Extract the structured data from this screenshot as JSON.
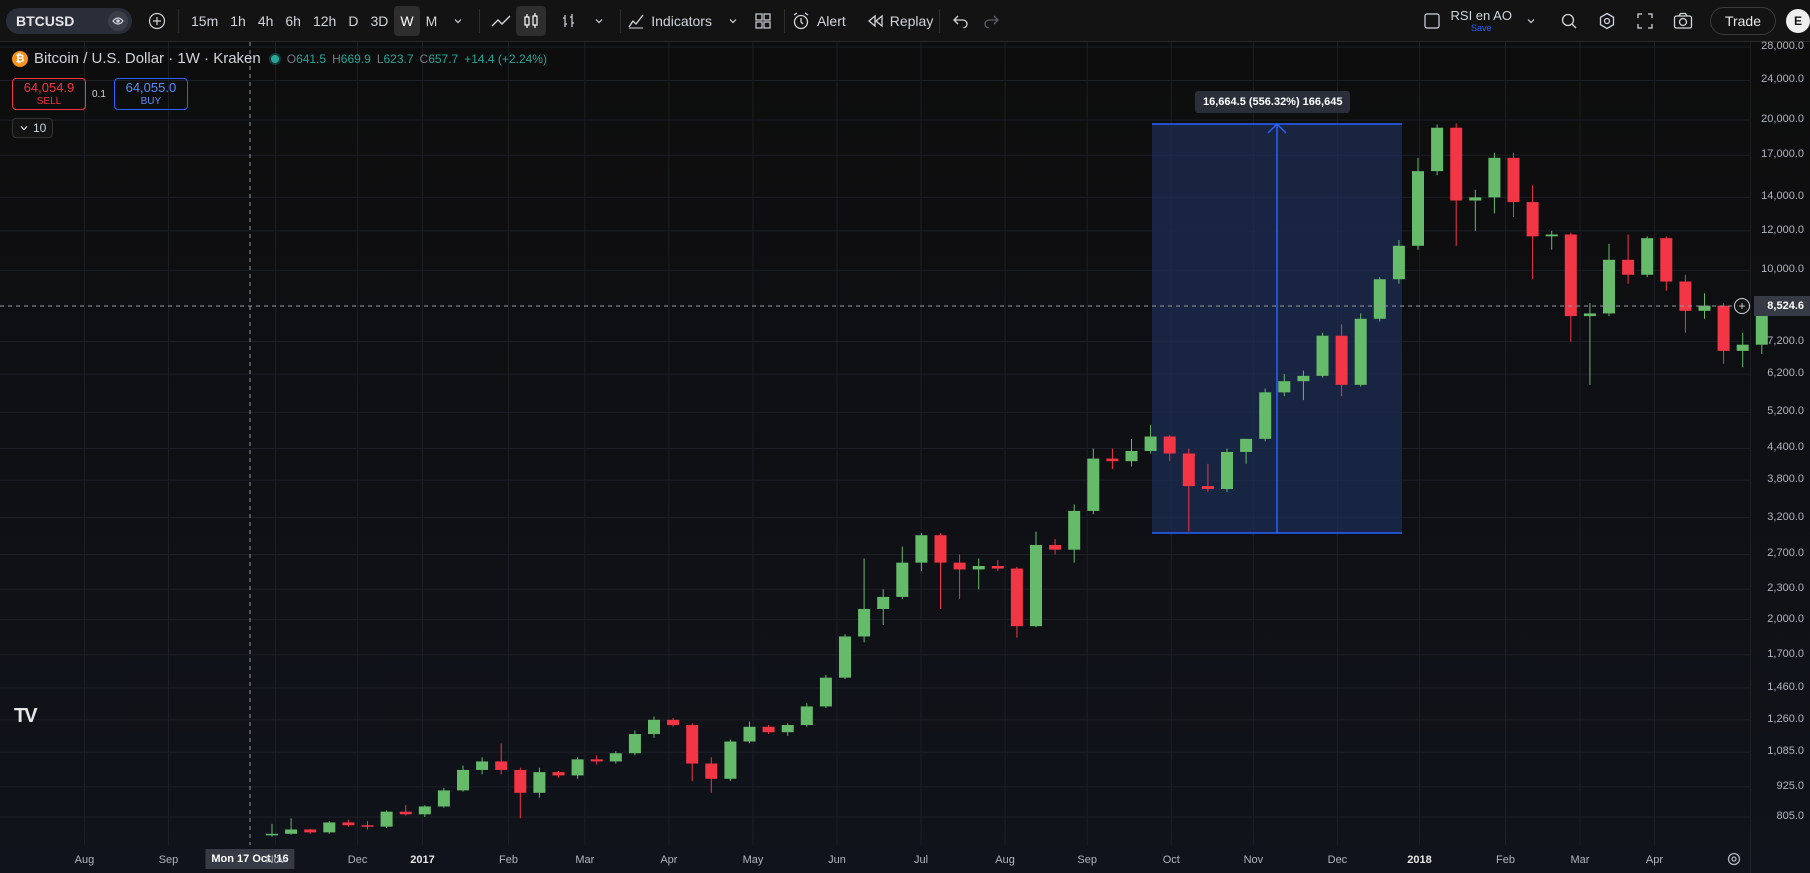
{
  "toolbar": {
    "symbol": "BTCUSD",
    "intervals": [
      "15m",
      "1h",
      "4h",
      "6h",
      "12h",
      "D",
      "3D",
      "W",
      "M"
    ],
    "active_interval": "W",
    "indicators_label": "Indicators",
    "alert_label": "Alert",
    "replay_label": "Replay",
    "layout_name": "RSI en AO",
    "layout_save": "Save",
    "trade_label": "Trade",
    "avatar_letter": "E"
  },
  "legend": {
    "title": "Bitcoin / U.S. Dollar · 1W · Kraken",
    "btc_glyph": "₿",
    "o_label": "O",
    "o_value": "641.5",
    "h_label": "H",
    "h_value": "669.9",
    "l_label": "L",
    "l_value": "623.7",
    "c_label": "C",
    "c_value": "657.7",
    "change": "+14.4 (+2.24%)"
  },
  "trade_panel": {
    "sell_price": "64,054.9",
    "sell_label": "SELL",
    "spread": "0.1",
    "buy_price": "64,055.0",
    "buy_label": "BUY"
  },
  "collapse_label": "10",
  "tv_logo": "TV",
  "measure": {
    "text": "16,664.5 (556.32%) 166,645"
  },
  "cursor": {
    "price": "8,524.6",
    "time": "Mon 17 Oct '16"
  },
  "price_axis": {
    "ticks": [
      "28,000.0",
      "24,000.0",
      "20,000.0",
      "17,000.0",
      "14,000.0",
      "12,000.0",
      "10,000.0",
      "7,200.0",
      "6,200.0",
      "5,200.0",
      "4,400.0",
      "3,800.0",
      "3,200.0",
      "2,700.0",
      "2,300.0",
      "2,000.0",
      "1,700.0",
      "1,460.0",
      "1,260.0",
      "1,085.0",
      "925.0",
      "805.0"
    ]
  },
  "time_axis": {
    "ticks": [
      {
        "label": "Aug",
        "bold": false
      },
      {
        "label": "Sep",
        "bold": false
      },
      {
        "label": "Nov",
        "bold": false
      },
      {
        "label": "Dec",
        "bold": false
      },
      {
        "label": "2017",
        "bold": true
      },
      {
        "label": "Feb",
        "bold": false
      },
      {
        "label": "Mar",
        "bold": false
      },
      {
        "label": "Apr",
        "bold": false
      },
      {
        "label": "May",
        "bold": false
      },
      {
        "label": "Jun",
        "bold": false
      },
      {
        "label": "Jul",
        "bold": false
      },
      {
        "label": "Aug",
        "bold": false
      },
      {
        "label": "Sep",
        "bold": false
      },
      {
        "label": "Oct",
        "bold": false
      },
      {
        "label": "Nov",
        "bold": false
      },
      {
        "label": "Dec",
        "bold": false
      },
      {
        "label": "2018",
        "bold": true
      },
      {
        "label": "Feb",
        "bold": false
      },
      {
        "label": "Mar",
        "bold": false
      },
      {
        "label": "Apr",
        "bold": false
      }
    ]
  },
  "colors": {
    "up": "#66bb6a",
    "down": "#f23645",
    "measure_fill": "#1c2c52",
    "measure_line": "#2962ff"
  },
  "chart_data": {
    "type": "candlestick",
    "candles": [
      {
        "o": 741,
        "h": 780,
        "l": 735,
        "c": 745
      },
      {
        "o": 745,
        "h": 800,
        "l": 742,
        "c": 760
      },
      {
        "o": 760,
        "h": 762,
        "l": 745,
        "c": 750
      },
      {
        "o": 750,
        "h": 790,
        "l": 745,
        "c": 785
      },
      {
        "o": 785,
        "h": 795,
        "l": 770,
        "c": 775
      },
      {
        "o": 775,
        "h": 790,
        "l": 760,
        "c": 770
      },
      {
        "o": 770,
        "h": 830,
        "l": 765,
        "c": 825
      },
      {
        "o": 825,
        "h": 850,
        "l": 810,
        "c": 815
      },
      {
        "o": 815,
        "h": 850,
        "l": 805,
        "c": 845
      },
      {
        "o": 845,
        "h": 920,
        "l": 840,
        "c": 910
      },
      {
        "o": 910,
        "h": 1020,
        "l": 905,
        "c": 1000
      },
      {
        "o": 1000,
        "h": 1060,
        "l": 980,
        "c": 1040
      },
      {
        "o": 1040,
        "h": 1130,
        "l": 980,
        "c": 1000
      },
      {
        "o": 1000,
        "h": 1010,
        "l": 800,
        "c": 900
      },
      {
        "o": 900,
        "h": 1010,
        "l": 880,
        "c": 990
      },
      {
        "o": 990,
        "h": 995,
        "l": 965,
        "c": 975
      },
      {
        "o": 975,
        "h": 1060,
        "l": 960,
        "c": 1050
      },
      {
        "o": 1050,
        "h": 1070,
        "l": 1025,
        "c": 1040
      },
      {
        "o": 1040,
        "h": 1090,
        "l": 1030,
        "c": 1080
      },
      {
        "o": 1080,
        "h": 1200,
        "l": 1070,
        "c": 1180
      },
      {
        "o": 1180,
        "h": 1280,
        "l": 1160,
        "c": 1260
      },
      {
        "o": 1260,
        "h": 1270,
        "l": 1220,
        "c": 1230
      },
      {
        "o": 1230,
        "h": 1240,
        "l": 950,
        "c": 1030
      },
      {
        "o": 1030,
        "h": 1060,
        "l": 900,
        "c": 960
      },
      {
        "o": 960,
        "h": 1150,
        "l": 950,
        "c": 1140
      },
      {
        "o": 1140,
        "h": 1250,
        "l": 1130,
        "c": 1220
      },
      {
        "o": 1220,
        "h": 1230,
        "l": 1180,
        "c": 1190
      },
      {
        "o": 1190,
        "h": 1240,
        "l": 1170,
        "c": 1230
      },
      {
        "o": 1230,
        "h": 1360,
        "l": 1220,
        "c": 1340
      },
      {
        "o": 1340,
        "h": 1550,
        "l": 1330,
        "c": 1530
      },
      {
        "o": 1530,
        "h": 1870,
        "l": 1520,
        "c": 1850
      },
      {
        "o": 1850,
        "h": 2650,
        "l": 1800,
        "c": 2100
      },
      {
        "o": 2100,
        "h": 2300,
        "l": 1950,
        "c": 2220
      },
      {
        "o": 2220,
        "h": 2800,
        "l": 2200,
        "c": 2600
      },
      {
        "o": 2600,
        "h": 2980,
        "l": 2500,
        "c": 2950
      },
      {
        "o": 2950,
        "h": 2980,
        "l": 2100,
        "c": 2600
      },
      {
        "o": 2600,
        "h": 2700,
        "l": 2200,
        "c": 2520
      },
      {
        "o": 2520,
        "h": 2650,
        "l": 2300,
        "c": 2560
      },
      {
        "o": 2560,
        "h": 2630,
        "l": 2500,
        "c": 2530
      },
      {
        "o": 2530,
        "h": 2550,
        "l": 1840,
        "c": 1940
      },
      {
        "o": 1940,
        "h": 3000,
        "l": 1930,
        "c": 2820
      },
      {
        "o": 2820,
        "h": 2900,
        "l": 2700,
        "c": 2760
      },
      {
        "o": 2760,
        "h": 3400,
        "l": 2600,
        "c": 3300
      },
      {
        "o": 3300,
        "h": 4400,
        "l": 3250,
        "c": 4200
      },
      {
        "o": 4200,
        "h": 4400,
        "l": 4000,
        "c": 4150
      },
      {
        "o": 4150,
        "h": 4600,
        "l": 4050,
        "c": 4350
      },
      {
        "o": 4350,
        "h": 4900,
        "l": 4300,
        "c": 4650
      },
      {
        "o": 4650,
        "h": 4680,
        "l": 4150,
        "c": 4300
      },
      {
        "o": 4300,
        "h": 4400,
        "l": 3000,
        "c": 3700
      },
      {
        "o": 3700,
        "h": 4100,
        "l": 3600,
        "c": 3650
      },
      {
        "o": 3650,
        "h": 4400,
        "l": 3600,
        "c": 4330
      },
      {
        "o": 4330,
        "h": 4500,
        "l": 4100,
        "c": 4600
      },
      {
        "o": 4600,
        "h": 5800,
        "l": 4550,
        "c": 5700
      },
      {
        "o": 5700,
        "h": 6200,
        "l": 5600,
        "c": 6000
      },
      {
        "o": 6000,
        "h": 6300,
        "l": 5500,
        "c": 6150
      },
      {
        "o": 6150,
        "h": 7500,
        "l": 6100,
        "c": 7400
      },
      {
        "o": 7400,
        "h": 7800,
        "l": 5600,
        "c": 5900
      },
      {
        "o": 5900,
        "h": 8200,
        "l": 5850,
        "c": 8000
      },
      {
        "o": 8000,
        "h": 9700,
        "l": 7900,
        "c": 9600
      },
      {
        "o": 9600,
        "h": 11500,
        "l": 9400,
        "c": 11200
      },
      {
        "o": 11200,
        "h": 16800,
        "l": 11000,
        "c": 15800
      },
      {
        "o": 15800,
        "h": 19600,
        "l": 15500,
        "c": 19300
      },
      {
        "o": 19300,
        "h": 19700,
        "l": 11200,
        "c": 13800
      },
      {
        "o": 13800,
        "h": 14500,
        "l": 12000,
        "c": 14000
      },
      {
        "o": 14000,
        "h": 17200,
        "l": 13000,
        "c": 16800
      },
      {
        "o": 16800,
        "h": 17200,
        "l": 12800,
        "c": 13700
      },
      {
        "o": 13700,
        "h": 14800,
        "l": 9600,
        "c": 11700
      },
      {
        "o": 11700,
        "h": 12000,
        "l": 11000,
        "c": 11800
      },
      {
        "o": 11800,
        "h": 11900,
        "l": 7200,
        "c": 8100
      },
      {
        "o": 8100,
        "h": 8600,
        "l": 5900,
        "c": 8200
      },
      {
        "o": 8200,
        "h": 11300,
        "l": 8100,
        "c": 10500
      },
      {
        "o": 10500,
        "h": 11800,
        "l": 9400,
        "c": 9800
      },
      {
        "o": 9800,
        "h": 11700,
        "l": 9700,
        "c": 11600
      },
      {
        "o": 11600,
        "h": 11700,
        "l": 9100,
        "c": 9500
      },
      {
        "o": 9500,
        "h": 9800,
        "l": 7500,
        "c": 8300
      },
      {
        "o": 8300,
        "h": 9000,
        "l": 8000,
        "c": 8500
      },
      {
        "o": 8500,
        "h": 8600,
        "l": 6500,
        "c": 6900
      },
      {
        "o": 6900,
        "h": 7500,
        "l": 6400,
        "c": 7100
      },
      {
        "o": 7100,
        "h": 8500,
        "l": 6800,
        "c": 8400
      }
    ]
  }
}
